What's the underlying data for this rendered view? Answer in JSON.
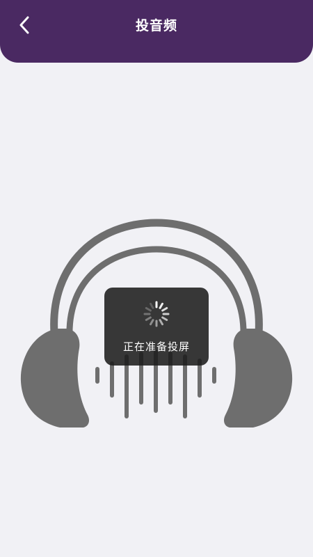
{
  "header": {
    "title": "投音频",
    "back_icon": "chevron-left-icon",
    "background_color": "#4a2962"
  },
  "main": {
    "illustration_icon": "headphones-audio-icon",
    "illustration_color": "#6e6e6e"
  },
  "toast": {
    "icon": "loading-spinner-icon",
    "message": "正在准备投屏"
  }
}
